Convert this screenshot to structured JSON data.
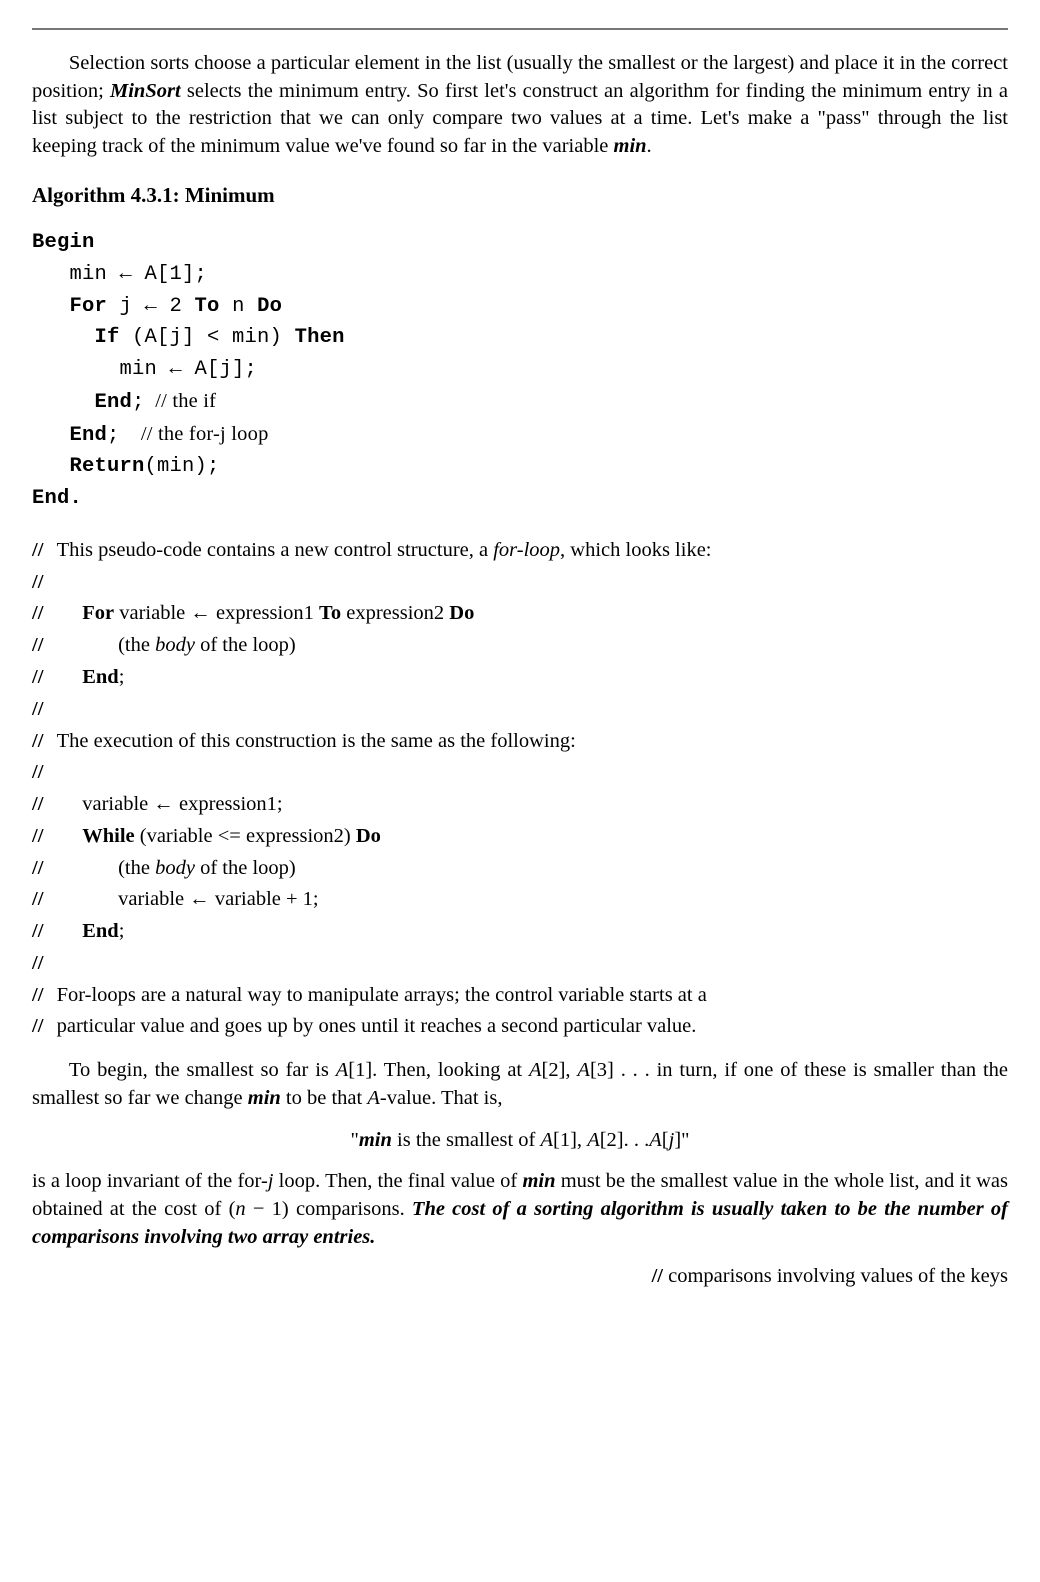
{
  "para1_a": "Selection sorts choose a particular element in the list (usually the smallest or the largest) and place it in the correct position; ",
  "minsort": "MinSort",
  "para1_b": " selects the minimum entry. So first let's construct an algorithm for finding the minimum entry in a list subject to the restriction that we can only compare two values at a time. Let's make a \"pass\" through the list keeping track of the minimum value we've found so far in the variable ",
  "min_word": "min",
  "period": ".",
  "algo_title": "Algorithm 4.3.1: Minimum",
  "kw_begin": "Begin",
  "line_min_a1": "   min ← A[1];",
  "kw_for": "For",
  "for_mid": " j ← 2 ",
  "kw_to": "To",
  "for_n": " n ",
  "kw_do": "Do",
  "kw_if": "If",
  "if_cond": " (A[j] < min) ",
  "kw_then": "Then",
  "line_min_aj": "       min ← A[j];",
  "kw_end": "End",
  "semi": ";",
  "cmt_if": "  // the if",
  "cmt_forj": "    // the for-j loop",
  "kw_return": "Return",
  "return_arg": "(min);",
  "kw_end_dot": "End.",
  "sl": "//",
  "c_intro_a": " This pseudo-code contains a new control structure, a ",
  "forloop_it": "for-loop",
  "c_intro_b": ", which looks like:",
  "c_for": "For",
  "c_for_mid": " variable  ←  expression1 ",
  "c_to": "To",
  "c_expr2": " expression2 ",
  "c_do": "Do",
  "c_body_a": "(the ",
  "c_body_it": "body",
  "c_body_b": " of the loop)",
  "c_end": "End",
  "c_semi": ";",
  "c_exec": " The execution of this construction is the same as the following:",
  "c_var_e1": "variable ← expression1;",
  "c_while": "While",
  "c_while_cond": " (variable <= expression2) ",
  "c_varinc": "variable ← variable + 1;",
  "c_tail1": " For-loops are a natural way to manipulate arrays; the control variable starts at a",
  "c_tail2": " particular value and goes up by ones until it reaches a second particular value.",
  "para2_a": "To begin, the smallest so far is ",
  "A1": "A",
  "br1": "[1]. Then, looking at ",
  "br2": "[2], ",
  "br3": "[3] . . .  in turn, if one of these is smaller than the smallest so far we change ",
  "para2_b": " to be that ",
  "A_letter": "A",
  "para2_c": "-value. That is,",
  "center_a": "\"",
  "center_b": " is the smallest of ",
  "center_c": "[1], ",
  "center_d": "[2]. . .",
  "center_j": "j",
  "center_e": "]\"",
  "openbr": "[",
  "para3_a": "is a loop invariant of the for-",
  "j_it": "j",
  "para3_b": " loop. Then, the final value of ",
  "para3_c": " must be the smallest value in the whole list, and it was obtained at the cost of (",
  "n_it": "n",
  "para3_d": " − 1) comparisons. ",
  "para3_bold": "The cost of a sorting algorithm is usually taken to be the number of comparisons involving two array entries.",
  "rightcmt": "// comparisons involving values of the keys"
}
